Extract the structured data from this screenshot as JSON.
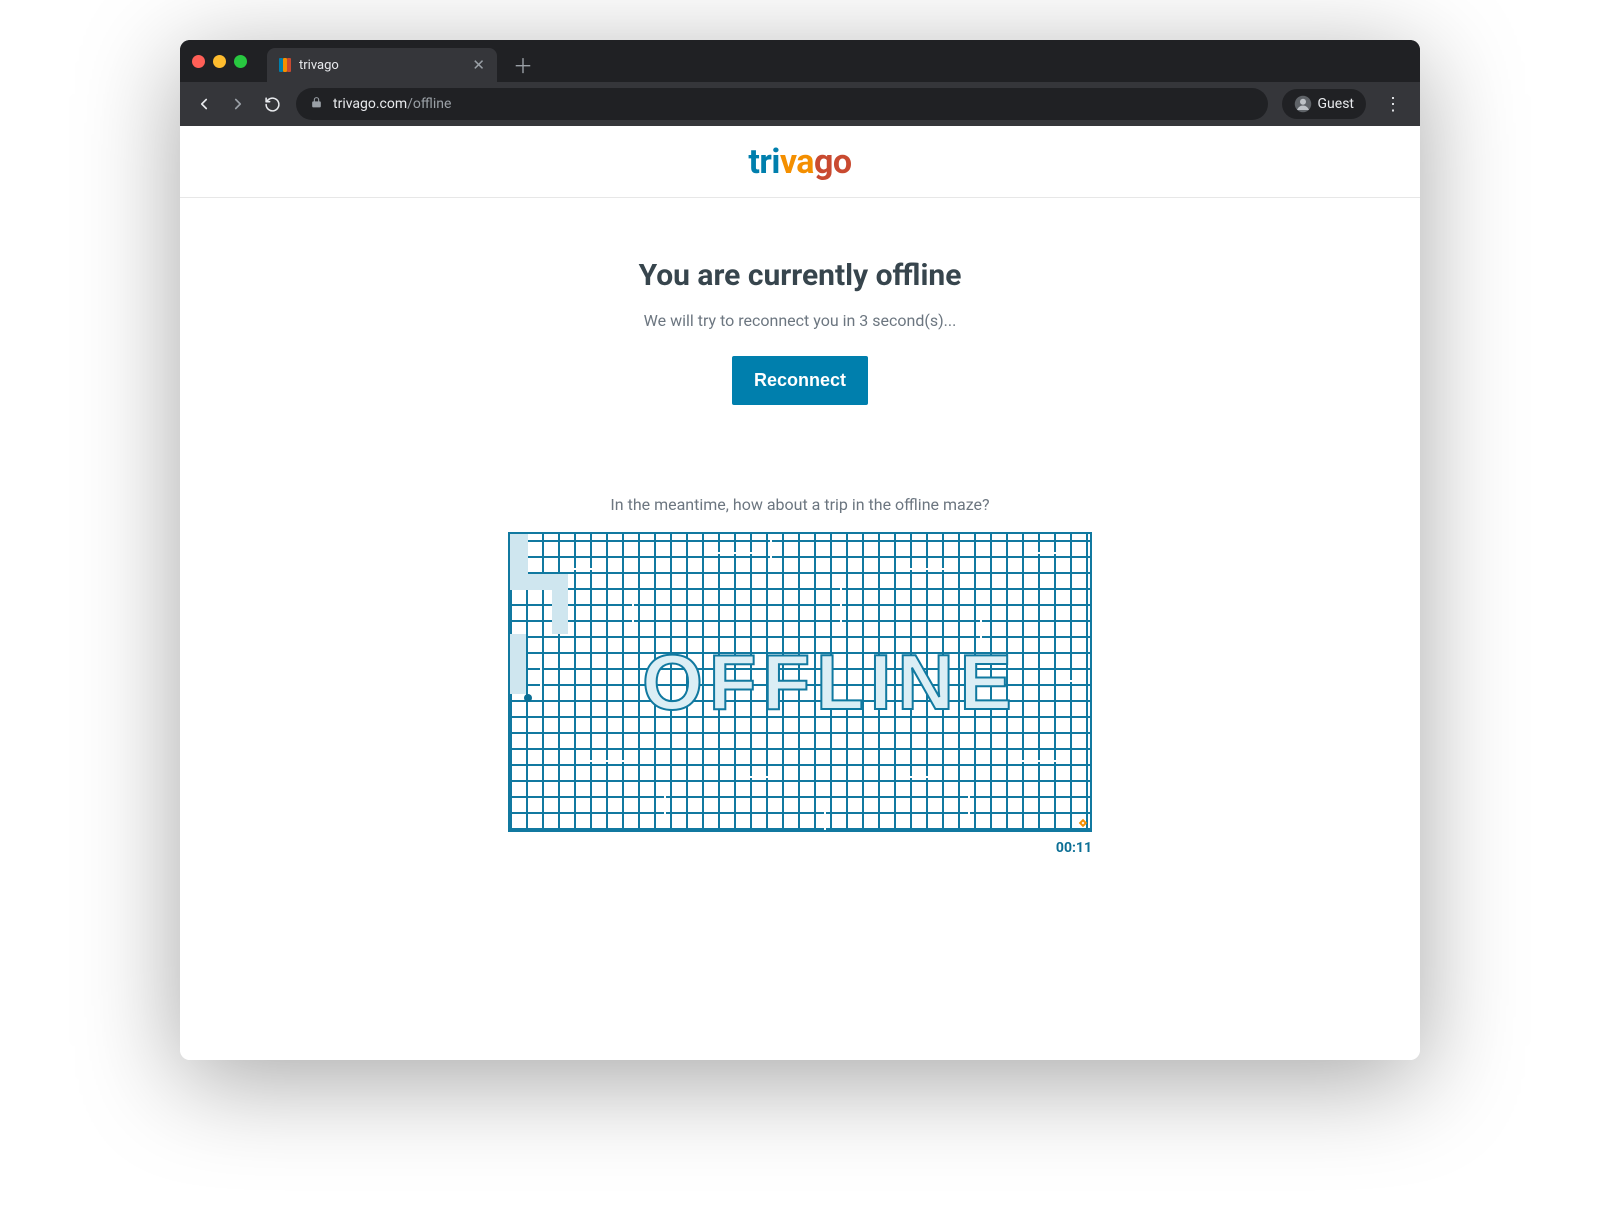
{
  "browser": {
    "tab_title": "trivago",
    "url_host": "trivago.com",
    "url_path": "/offline",
    "guest_label": "Guest"
  },
  "brand": {
    "seg1": "tri",
    "seg2": "va",
    "seg3": "go"
  },
  "page": {
    "headline": "You are currently offline",
    "subtext": "We will try to reconnect you in 3 second(s)...",
    "reconnect_label": "Reconnect",
    "maze_prompt": "In the meantime, how about a trip in the offline maze?",
    "maze_word": "OFFLINE",
    "timer": "00:11"
  },
  "colors": {
    "brand_blue": "#007fad",
    "brand_orange": "#f48f00",
    "brand_red": "#c94a30",
    "maze_stroke": "#1179a0"
  }
}
